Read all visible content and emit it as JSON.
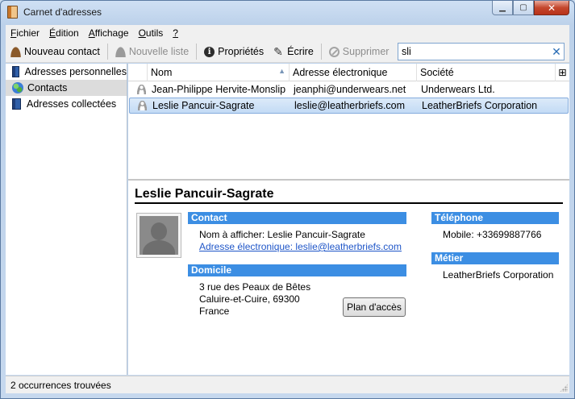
{
  "window": {
    "title": "Carnet d'adresses",
    "controls": {
      "minimize": "▁",
      "maximize": "▢",
      "close": "✕"
    }
  },
  "menubar": {
    "items": [
      {
        "label": "Fichier",
        "underline": "F",
        "rest": "ichier"
      },
      {
        "label": "Édition",
        "underline": "É",
        "rest": "dition"
      },
      {
        "label": "Affichage",
        "underline": "A",
        "rest": "ffichage"
      },
      {
        "label": "Outils",
        "underline": "O",
        "rest": "utils"
      },
      {
        "label": "?",
        "underline": "?",
        "rest": ""
      }
    ]
  },
  "toolbar": {
    "new_contact": "Nouveau contact",
    "new_list": "Nouvelle liste",
    "properties": "Propriétés",
    "write": "Écrire",
    "delete": "Supprimer",
    "search_value": "sli",
    "search_clear": "✕"
  },
  "sidebar": {
    "items": [
      {
        "label": "Adresses personnelles",
        "icon": "address-book-icon",
        "selected": false
      },
      {
        "label": "Contacts",
        "icon": "globe-icon",
        "selected": true
      },
      {
        "label": "Adresses collectées",
        "icon": "address-book-icon",
        "selected": false
      }
    ]
  },
  "results": {
    "columns": {
      "name": "Nom",
      "email": "Adresse électronique",
      "org": "Société",
      "sort_indicator": "▲",
      "picker": "⊞"
    },
    "rows": [
      {
        "name": "Jean-Philippe Hervite-Monslip",
        "email": "jeanphi@underwears.net",
        "org": "Underwears Ltd.",
        "selected": false
      },
      {
        "name": "Leslie Pancuir-Sagrate",
        "email": "leslie@leatherbriefs.com",
        "org": "LeatherBriefs Corporation",
        "selected": true
      }
    ]
  },
  "card": {
    "name": "Leslie Pancuir-Sagrate",
    "contact": {
      "heading": "Contact",
      "display_name": "Nom à afficher: Leslie Pancuir-Sagrate",
      "email": "Adresse électronique: leslie@leatherbriefs.com"
    },
    "home": {
      "heading": "Domicile",
      "line1": "3 rue des Peaux de Bêtes",
      "line2": "Caluire-et-Cuire, 69300",
      "line3": "France",
      "map_button": "Plan d'accès"
    },
    "phone": {
      "heading": "Téléphone",
      "mobile": "Mobile: +33699887766"
    },
    "work": {
      "heading": "Métier",
      "company": "LeatherBriefs Corporation"
    }
  },
  "status": {
    "text": "2 occurrences trouvées"
  },
  "colors": {
    "section_header": "#3c8ee3",
    "link": "#1f56c8",
    "selection": "#c3dbf5"
  }
}
